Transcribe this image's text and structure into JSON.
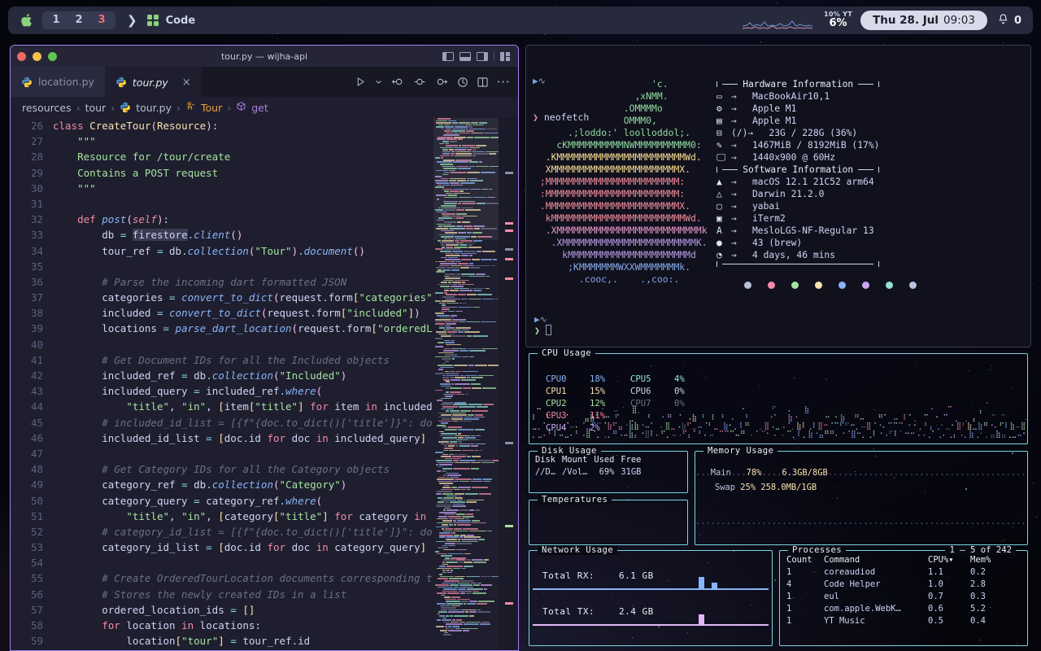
{
  "menubar": {
    "apple_icon": "apple-logo-icon",
    "spaces": [
      "1",
      "2",
      "3"
    ],
    "active_space": "3",
    "chevron": "❯",
    "app_icon": "grid-app-icon",
    "app_name": "Code",
    "yt_label": "10% YT",
    "yt_value": "6%",
    "clock_day": "Thu 28. Jul",
    "clock_time": "09:03",
    "bell_icon": "bell-icon",
    "notification_count": "0"
  },
  "vscode": {
    "title": "tour.py — wijha-api",
    "tabs": [
      {
        "label": "location.py",
        "icon": "python-icon",
        "active": false
      },
      {
        "label": "tour.py",
        "icon": "python-icon",
        "active": true,
        "close": "×"
      }
    ],
    "breadcrumb": [
      "resources",
      "tour",
      "tour.py",
      "Tour",
      "get"
    ],
    "breadcrumb_sep": "›",
    "actions": [
      "run-icon",
      "run-dropdown-icon",
      "step-back-icon",
      "step-over-icon",
      "step-into-icon",
      "debug-icon",
      "split-editor-icon",
      "more-actions-icon"
    ],
    "layout_icons": [
      "toggle-primary-sidebar-icon",
      "toggle-panel-icon",
      "toggle-secondary-sidebar-icon",
      "customize-layout-icon"
    ],
    "first_line_number": 26,
    "code_lines": [
      {
        "n": 26,
        "t": "class CreateTour(Resource):"
      },
      {
        "n": 27,
        "t": "    \"\"\""
      },
      {
        "n": 28,
        "t": "    Resource for /tour/create"
      },
      {
        "n": 29,
        "t": "    Contains a POST request"
      },
      {
        "n": 30,
        "t": "    \"\"\""
      },
      {
        "n": 31,
        "t": ""
      },
      {
        "n": 32,
        "t": "    def post(self):"
      },
      {
        "n": 33,
        "t": "        db = firestore.client()"
      },
      {
        "n": 34,
        "t": "        tour_ref = db.collection(\"Tour\").document()"
      },
      {
        "n": 35,
        "t": ""
      },
      {
        "n": 36,
        "t": "        # Parse the incoming dart formatted JSON"
      },
      {
        "n": 37,
        "t": "        categories = convert_to_dict(request.form[\"categories\"])"
      },
      {
        "n": 38,
        "t": "        included = convert_to_dict(request.form[\"included\"])"
      },
      {
        "n": 39,
        "t": "        locations = parse_dart_location(request.form[\"orderedL"
      },
      {
        "n": 40,
        "t": ""
      },
      {
        "n": 41,
        "t": "        # Get Document IDs for all the Included objects"
      },
      {
        "n": 42,
        "t": "        included_ref = db.collection(\"Included\")"
      },
      {
        "n": 43,
        "t": "        included_query = included_ref.where("
      },
      {
        "n": 44,
        "t": "            \"title\", \"in\", [item[\"title\"] for item in included"
      },
      {
        "n": 45,
        "t": "        # included_id_list = [{f\"{doc.to_dict()['title']}\": do"
      },
      {
        "n": 46,
        "t": "        included_id_list = [doc.id for doc in included_query]"
      },
      {
        "n": 47,
        "t": ""
      },
      {
        "n": 48,
        "t": "        # Get Category IDs for all the Category objects"
      },
      {
        "n": 49,
        "t": "        category_ref = db.collection(\"Category\")"
      },
      {
        "n": 50,
        "t": "        category_query = category_ref.where("
      },
      {
        "n": 51,
        "t": "            \"title\", \"in\", [category[\"title\"] for category in"
      },
      {
        "n": 52,
        "t": "        # category_id_list = [{f\"{doc.to_dict()['title']}\": do"
      },
      {
        "n": 53,
        "t": "        category_id_list = [doc.id for doc in category_query]"
      },
      {
        "n": 54,
        "t": ""
      },
      {
        "n": 55,
        "t": "        # Create OrderedTourLocation documents corresponding t"
      },
      {
        "n": 56,
        "t": "        # Stores the newly created IDs in a list"
      },
      {
        "n": 57,
        "t": "        ordered_location_ids = []"
      },
      {
        "n": 58,
        "t": "        for location in locations:"
      },
      {
        "n": 59,
        "t": "            location[\"tour\"] = tour_ref.id"
      }
    ]
  },
  "terminal": {
    "prompt": "❯",
    "command": "neofetch",
    "ascii_art": [
      "                     'c.",
      "                  ,xNMM.",
      "                .OMMMMo",
      "                OMMM0,",
      "      .;loddo:' loolloddol;.",
      "    cKMMMMMMMMMMNWMMMMMMMMMM0:",
      "  .KMMMMMMMMMMMMMMMMMMMMMMMWd.",
      "  XMMMMMMMMMMMMMMMMMMMMMMMX.",
      " ;MMMMMMMMMMMMMMMMMMMMMMMM:",
      " :MMMMMMMMMMMMMMMMMMMMMMMM:",
      " .MMMMMMMMMMMMMMMMMMMMMMMMX.",
      "  kMMMMMMMMMMMMMMMMMMMMMMMMWd.",
      "  .XMMMMMMMMMMMMMMMMMMMMMMMMMMk",
      "   .XMMMMMMMMMMMMMMMMMMMMMMMMK.",
      "     kMMMMMMMMMMMMMMMMMMMMMMd",
      "      ;KMMMMMMMWXXWMMMMMMMk.",
      "        .cooc,.    .,coo:."
    ],
    "hardware_title": "Hardware Information",
    "software_title": "Software Information",
    "hardware": [
      {
        "icon": "laptop-icon",
        "arrow": "→",
        "value": "MacBookAir10,1"
      },
      {
        "icon": "cpu-icon",
        "arrow": "→",
        "value": "Apple M1"
      },
      {
        "icon": "gpu-icon",
        "arrow": "→",
        "value": "Apple M1"
      },
      {
        "icon": "disk-icon",
        "label": "(/)",
        "arrow": "→",
        "value": "23G / 228G (36%)"
      },
      {
        "icon": "memory-icon",
        "arrow": "→",
        "value": "1467MiB / 8192MiB (17%)"
      },
      {
        "icon": "display-icon",
        "arrow": "→",
        "value": "1440x900 @ 60Hz"
      }
    ],
    "software": [
      {
        "icon": "apple-icon",
        "arrow": "→",
        "value": "macOS 12.1 21C52 arm64"
      },
      {
        "icon": "kernel-icon",
        "arrow": "→",
        "value": "Darwin 21.2.0"
      },
      {
        "icon": "wm-icon",
        "arrow": "→",
        "value": "yabai"
      },
      {
        "icon": "terminal-icon",
        "arrow": "→",
        "value": "iTerm2"
      },
      {
        "icon": "font-icon",
        "arrow": "→",
        "value": "MesloLGS-NF-Regular 13"
      },
      {
        "icon": "packages-icon",
        "arrow": "→",
        "value": "43 (brew)"
      },
      {
        "icon": "uptime-icon",
        "arrow": "→",
        "value": "4 days, 46 mins"
      }
    ],
    "palette": [
      "#b9c2d9",
      "#f38ba8",
      "#a6e3a1",
      "#f9e2af",
      "#89b4fa",
      "#cba6f7",
      "#94e2d5",
      "#bac2de"
    ]
  },
  "dashboard": {
    "cpu": {
      "title": "CPU Usage",
      "cores": [
        {
          "name": "CPU0",
          "value": "18%",
          "color": "#89b4fa"
        },
        {
          "name": "CPU1",
          "value": "15%",
          "color": "#f9e2af"
        },
        {
          "name": "CPU2",
          "value": "12%",
          "color": "#a6e3a1"
        },
        {
          "name": "CPU3",
          "value": "11%",
          "color": "#f38ba8"
        },
        {
          "name": "CPU4",
          "value": "2%",
          "color": "#cba6f7"
        },
        {
          "name": "CPU5",
          "value": "4%",
          "color": "#94e2d5"
        },
        {
          "name": "CPU6",
          "value": "0%",
          "color": "#cdd6f4"
        },
        {
          "name": "CPU7",
          "value": "0%",
          "color": "#6c7086"
        }
      ]
    },
    "disk": {
      "title": "Disk Usage",
      "headers": [
        "Disk",
        "Mount",
        "Used",
        "Free"
      ],
      "rows": [
        [
          "//D…",
          "/Vol…",
          "69%",
          "31GB"
        ]
      ]
    },
    "temperatures": {
      "title": "Temperatures",
      "rows": []
    },
    "memory": {
      "title": "Memory Usage",
      "main_label": "Main",
      "main_pct": "78%",
      "main_value": "6.3GB/8GB",
      "swap_label": "Swap",
      "swap_pct": "25%",
      "swap_value": "258.0MB/1GB"
    },
    "network": {
      "title": "Network Usage",
      "rx_label": "Total RX:",
      "rx_value": "6.1 GB",
      "tx_label": "Total TX:",
      "tx_value": "2.4 GB",
      "rx_color": "#89b4fa",
      "tx_color": "#e3b8f5"
    },
    "processes": {
      "title": "Processes",
      "range": "1 – 5 of 242",
      "headers": [
        "Count",
        "Command",
        "CPU%▾",
        "Mem%"
      ],
      "rows": [
        [
          "1",
          "coreaudiod",
          "1.1",
          "0.2"
        ],
        [
          "4",
          "Code Helper",
          "1.0",
          "2.8"
        ],
        [
          "1",
          "eul",
          "0.7",
          "0.3"
        ],
        [
          "1",
          "com.apple.WebK…",
          "0.6",
          "5.2"
        ],
        [
          "1",
          "YT Music",
          "0.5",
          "0.4"
        ]
      ]
    }
  }
}
